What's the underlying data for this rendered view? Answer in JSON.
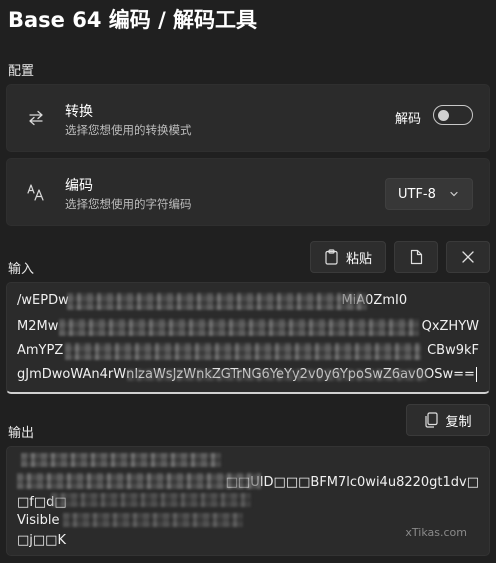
{
  "app": {
    "title": "Base 64 编码 / 解码工具"
  },
  "config": {
    "label": "配置",
    "convert": {
      "title": "转换",
      "desc": "选择您想使用的转换模式",
      "toggle_label": "解码",
      "toggle_on": false,
      "icon": "swap-arrows-icon"
    },
    "encoding": {
      "title": "编码",
      "desc": "选择您想使用的字符编码",
      "selected": "UTF-8",
      "icon": "font-size-icon"
    }
  },
  "input": {
    "label": "输入",
    "paste_label": "粘贴",
    "lines": [
      "/wEPDw                                                                  MiA0ZmI0",
      "M2Mw",
      "AmYPZ",
      "gJmDwoWAn4rWnIzaWsJzWnkZGTrNG6YeYy2v0y6YpoSwZ6av0OSw=="
    ],
    "line_tails": [
      "",
      "QxZHYW",
      "CBw9kF",
      ""
    ]
  },
  "output": {
    "label": "输出",
    "copy_label": "复制",
    "lines": [
      "",
      "□□UID□□□BFM7lc0wi4u8220gt1dv□",
      "□f□d□",
      "Visible",
      "□j□□K"
    ]
  },
  "watermark": "xTikas.com"
}
